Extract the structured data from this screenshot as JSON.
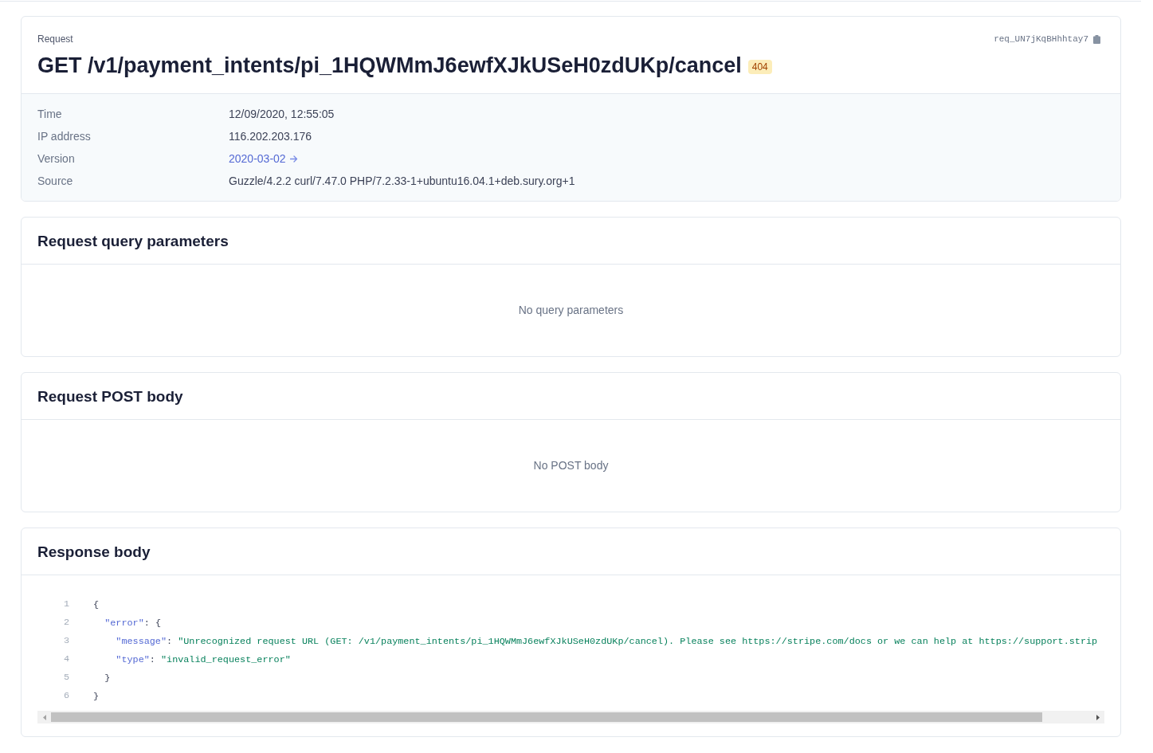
{
  "request": {
    "label": "Request",
    "title": "GET /v1/payment_intents/pi_1HQWMmJ6ewfXJkUSeH0zdUKp/cancel",
    "status": "404",
    "request_id": "req_UN7jKqBHhhtay7"
  },
  "details": [
    {
      "kind": "text",
      "label": "Time",
      "value": "12/09/2020, 12:55:05"
    },
    {
      "kind": "text",
      "label": "IP address",
      "value": "116.202.203.176"
    },
    {
      "kind": "link",
      "label": "Version",
      "value": "2020-03-02"
    },
    {
      "kind": "text",
      "label": "Source",
      "value": "Guzzle/4.2.2 curl/7.47.0 PHP/7.2.33-1+ubuntu16.04.1+deb.sury.org+1"
    }
  ],
  "sections": [
    {
      "kind": "empty",
      "title": "Request query parameters",
      "message": "No query parameters"
    },
    {
      "kind": "empty",
      "title": "Request POST body",
      "message": "No POST body"
    },
    {
      "kind": "code",
      "title": "Response body",
      "lines": [
        {
          "number": "1",
          "tokens": [
            {
              "kind": "punct",
              "text": "{"
            }
          ],
          "children": [
            {
              "number": "2",
              "tokens": [
                {
                  "kind": "key",
                  "text": "\"error\""
                },
                {
                  "kind": "punct",
                  "text": ": {"
                }
              ],
              "children": [
                {
                  "number": "3",
                  "tokens": [
                    {
                      "kind": "key",
                      "text": "\"message\""
                    },
                    {
                      "kind": "punct",
                      "text": ": "
                    },
                    {
                      "kind": "string",
                      "text": "\"Unrecognized request URL (GET: /v1/payment_intents/pi_1HQWMmJ6ewfXJkUSeH0zdUKp/cancel). Please see https://stripe.com/docs or we can help at https://support.strip"
                    }
                  ]
                },
                {
                  "number": "4",
                  "tokens": [
                    {
                      "kind": "key",
                      "text": "\"type\""
                    },
                    {
                      "kind": "punct",
                      "text": ": "
                    },
                    {
                      "kind": "string",
                      "text": "\"invalid_request_error\""
                    }
                  ]
                }
              ]
            },
            {
              "number": "5",
              "tokens": [
                {
                  "kind": "punct",
                  "text": "}"
                }
              ]
            }
          ]
        },
        {
          "number": "6",
          "tokens": [
            {
              "kind": "punct",
              "text": "}"
            }
          ]
        }
      ]
    }
  ]
}
